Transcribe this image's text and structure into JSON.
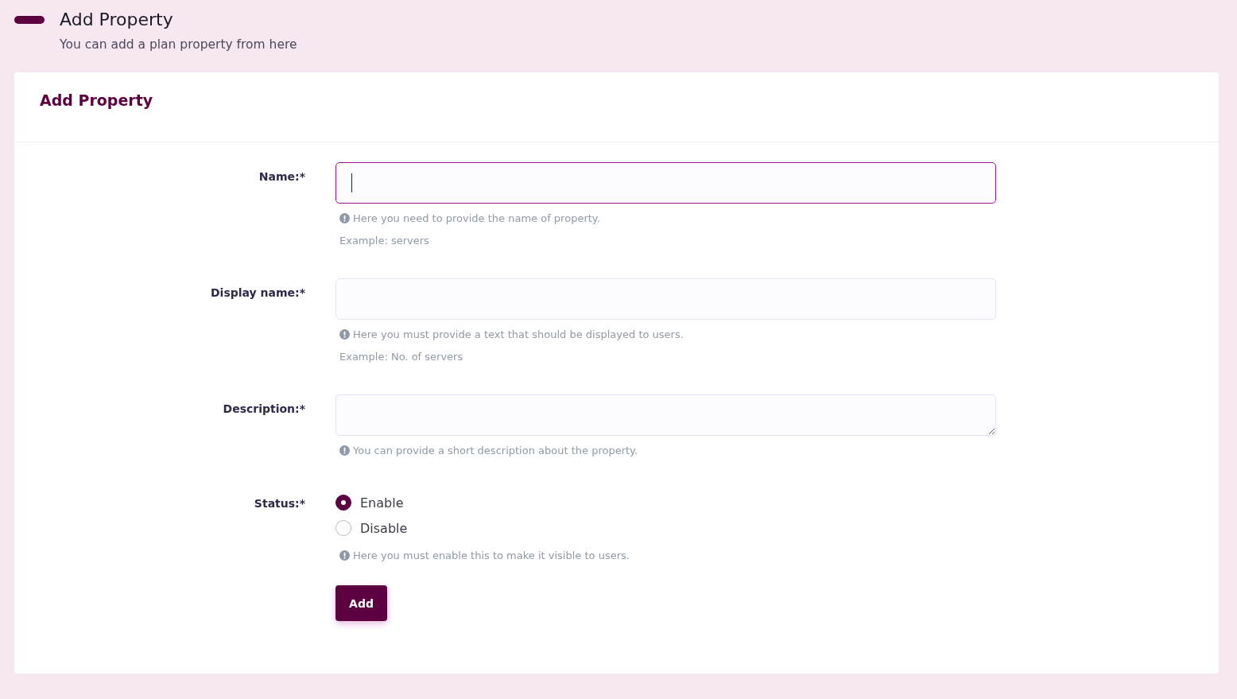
{
  "header": {
    "title": "Add Property",
    "subtitle": "You can add a plan property from here"
  },
  "card": {
    "title": "Add Property"
  },
  "fields": [
    {
      "kind": "text",
      "label": "Name:*",
      "focused": true,
      "hints": [
        "Here you need to provide the name of property."
      ],
      "example": "Example: servers"
    },
    {
      "kind": "text",
      "label": "Display name:*",
      "focused": false,
      "hints": [
        "Here you must provide a text that should be displayed to users."
      ],
      "example": "Example: No. of servers"
    },
    {
      "kind": "textarea",
      "label": "Description:*",
      "focused": false,
      "hints": [
        "You can provide a short description about the property."
      ]
    },
    {
      "kind": "radio",
      "label": "Status:*",
      "options": [
        {
          "label": "Enable",
          "selected": true
        },
        {
          "label": "Disable",
          "selected": false
        }
      ],
      "hints": [
        "Here you must enable this to make it visible to users."
      ]
    }
  ],
  "submit": {
    "label": "Add"
  }
}
